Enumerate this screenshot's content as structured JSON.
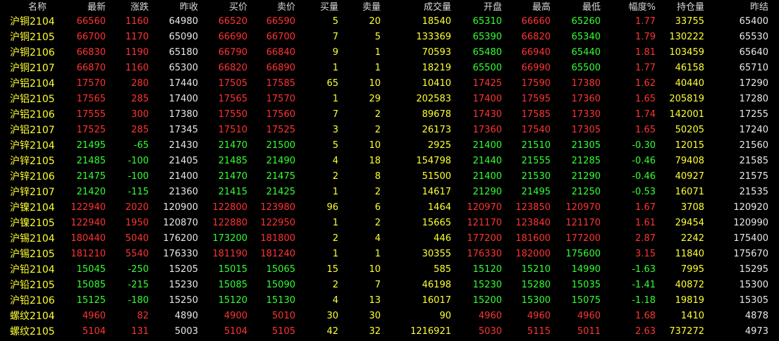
{
  "colors": {
    "background": "#000000",
    "header_text": "#d8d8d8",
    "name": "#ffff33",
    "up": "#ff3333",
    "down": "#33ff33",
    "neutral": "#e8e8e8",
    "volume": "#ffff33"
  },
  "columns": [
    {
      "key": "name",
      "label": "名称"
    },
    {
      "key": "last",
      "label": "最新"
    },
    {
      "key": "change",
      "label": "涨跌"
    },
    {
      "key": "prev_close",
      "label": "昨收"
    },
    {
      "key": "bid",
      "label": "买价"
    },
    {
      "key": "ask",
      "label": "卖价"
    },
    {
      "key": "bid_vol",
      "label": "买量"
    },
    {
      "key": "ask_vol",
      "label": "卖量"
    },
    {
      "key": "volume",
      "label": "成交量"
    },
    {
      "key": "open",
      "label": "开盘"
    },
    {
      "key": "high",
      "label": "最高"
    },
    {
      "key": "low",
      "label": "最低"
    },
    {
      "key": "pct",
      "label": "幅度%"
    },
    {
      "key": "oi",
      "label": "持仓量"
    },
    {
      "key": "prev_settle",
      "label": "昨结"
    }
  ],
  "rows": [
    {
      "name": "沪铜2104",
      "last": "66560",
      "change": "1160",
      "prev_close": "64980",
      "bid": "66520",
      "ask": "66590",
      "bid_vol": "5",
      "ask_vol": "20",
      "volume": "18540",
      "open": "65310",
      "high": "66660",
      "low": "65260",
      "pct": "1.77",
      "oi": "33755",
      "prev_settle": "65400"
    },
    {
      "name": "沪铜2105",
      "last": "66700",
      "change": "1170",
      "prev_close": "65090",
      "bid": "66690",
      "ask": "66700",
      "bid_vol": "7",
      "ask_vol": "5",
      "volume": "133369",
      "open": "65390",
      "high": "66820",
      "low": "65340",
      "pct": "1.79",
      "oi": "130222",
      "prev_settle": "65530"
    },
    {
      "name": "沪铜2106",
      "last": "66830",
      "change": "1190",
      "prev_close": "65180",
      "bid": "66790",
      "ask": "66840",
      "bid_vol": "9",
      "ask_vol": "1",
      "volume": "70593",
      "open": "65480",
      "high": "66940",
      "low": "65440",
      "pct": "1.81",
      "oi": "103459",
      "prev_settle": "65640"
    },
    {
      "name": "沪铜2107",
      "last": "66870",
      "change": "1160",
      "prev_close": "65300",
      "bid": "66820",
      "ask": "66890",
      "bid_vol": "1",
      "ask_vol": "1",
      "volume": "18219",
      "open": "65500",
      "high": "66990",
      "low": "65500",
      "pct": "1.77",
      "oi": "46158",
      "prev_settle": "65710"
    },
    {
      "name": "沪铝2104",
      "last": "17570",
      "change": "280",
      "prev_close": "17440",
      "bid": "17505",
      "ask": "17585",
      "bid_vol": "65",
      "ask_vol": "10",
      "volume": "10410",
      "open": "17425",
      "high": "17590",
      "low": "17380",
      "pct": "1.62",
      "oi": "40440",
      "prev_settle": "17290"
    },
    {
      "name": "沪铝2105",
      "last": "17565",
      "change": "285",
      "prev_close": "17400",
      "bid": "17565",
      "ask": "17570",
      "bid_vol": "1",
      "ask_vol": "29",
      "volume": "202583",
      "open": "17400",
      "high": "17595",
      "low": "17360",
      "pct": "1.65",
      "oi": "205819",
      "prev_settle": "17280"
    },
    {
      "name": "沪铝2106",
      "last": "17555",
      "change": "300",
      "prev_close": "17380",
      "bid": "17550",
      "ask": "17560",
      "bid_vol": "7",
      "ask_vol": "2",
      "volume": "89678",
      "open": "17430",
      "high": "17585",
      "low": "17330",
      "pct": "1.74",
      "oi": "142001",
      "prev_settle": "17255"
    },
    {
      "name": "沪铝2107",
      "last": "17525",
      "change": "285",
      "prev_close": "17345",
      "bid": "17510",
      "ask": "17525",
      "bid_vol": "3",
      "ask_vol": "2",
      "volume": "26173",
      "open": "17360",
      "high": "17540",
      "low": "17305",
      "pct": "1.65",
      "oi": "50205",
      "prev_settle": "17240"
    },
    {
      "name": "沪锌2104",
      "last": "21495",
      "change": "-65",
      "prev_close": "21430",
      "bid": "21470",
      "ask": "21500",
      "bid_vol": "5",
      "ask_vol": "10",
      "volume": "2925",
      "open": "21400",
      "high": "21510",
      "low": "21305",
      "pct": "-0.30",
      "oi": "12015",
      "prev_settle": "21560"
    },
    {
      "name": "沪锌2105",
      "last": "21485",
      "change": "-100",
      "prev_close": "21405",
      "bid": "21485",
      "ask": "21490",
      "bid_vol": "4",
      "ask_vol": "18",
      "volume": "154798",
      "open": "21440",
      "high": "21555",
      "low": "21285",
      "pct": "-0.46",
      "oi": "79408",
      "prev_settle": "21585"
    },
    {
      "name": "沪锌2106",
      "last": "21475",
      "change": "-100",
      "prev_close": "21400",
      "bid": "21470",
      "ask": "21475",
      "bid_vol": "2",
      "ask_vol": "8",
      "volume": "51500",
      "open": "21400",
      "high": "21530",
      "low": "21290",
      "pct": "-0.46",
      "oi": "40927",
      "prev_settle": "21575"
    },
    {
      "name": "沪锌2107",
      "last": "21420",
      "change": "-115",
      "prev_close": "21360",
      "bid": "21415",
      "ask": "21425",
      "bid_vol": "1",
      "ask_vol": "2",
      "volume": "14617",
      "open": "21290",
      "high": "21495",
      "low": "21250",
      "pct": "-0.53",
      "oi": "16071",
      "prev_settle": "21535"
    },
    {
      "name": "沪镍2104",
      "last": "122940",
      "change": "2020",
      "prev_close": "120900",
      "bid": "122800",
      "ask": "123980",
      "bid_vol": "96",
      "ask_vol": "6",
      "volume": "1464",
      "open": "120970",
      "high": "123850",
      "low": "120970",
      "pct": "1.67",
      "oi": "3708",
      "prev_settle": "120920"
    },
    {
      "name": "沪镍2105",
      "last": "122940",
      "change": "1950",
      "prev_close": "120870",
      "bid": "122880",
      "ask": "122950",
      "bid_vol": "1",
      "ask_vol": "2",
      "volume": "15665",
      "open": "121170",
      "high": "123840",
      "low": "121170",
      "pct": "1.61",
      "oi": "29454",
      "prev_settle": "120990"
    },
    {
      "name": "沪锡2104",
      "last": "180440",
      "change": "5040",
      "prev_close": "176200",
      "bid": "173200",
      "ask": "181800",
      "bid_vol": "2",
      "ask_vol": "4",
      "volume": "446",
      "open": "177200",
      "high": "181600",
      "low": "177200",
      "pct": "2.87",
      "oi": "2242",
      "prev_settle": "175400"
    },
    {
      "name": "沪锡2105",
      "last": "181210",
      "change": "5540",
      "prev_close": "176330",
      "bid": "181190",
      "ask": "181240",
      "bid_vol": "1",
      "ask_vol": "1",
      "volume": "30355",
      "open": "176330",
      "high": "182000",
      "low": "175600",
      "pct": "3.15",
      "oi": "11840",
      "prev_settle": "175670"
    },
    {
      "name": "沪铅2104",
      "last": "15045",
      "change": "-250",
      "prev_close": "15205",
      "bid": "15015",
      "ask": "15065",
      "bid_vol": "15",
      "ask_vol": "10",
      "volume": "585",
      "open": "15120",
      "high": "15210",
      "low": "14990",
      "pct": "-1.63",
      "oi": "7995",
      "prev_settle": "15295"
    },
    {
      "name": "沪铅2105",
      "last": "15085",
      "change": "-215",
      "prev_close": "15230",
      "bid": "15085",
      "ask": "15090",
      "bid_vol": "2",
      "ask_vol": "7",
      "volume": "46198",
      "open": "15230",
      "high": "15280",
      "low": "15035",
      "pct": "-1.41",
      "oi": "40872",
      "prev_settle": "15300"
    },
    {
      "name": "沪铅2106",
      "last": "15125",
      "change": "-180",
      "prev_close": "15250",
      "bid": "15120",
      "ask": "15130",
      "bid_vol": "4",
      "ask_vol": "13",
      "volume": "16017",
      "open": "15200",
      "high": "15300",
      "low": "15075",
      "pct": "-1.18",
      "oi": "19819",
      "prev_settle": "15305"
    },
    {
      "name": "螺纹2104",
      "last": "4960",
      "change": "82",
      "prev_close": "4890",
      "bid": "4900",
      "ask": "5010",
      "bid_vol": "30",
      "ask_vol": "30",
      "volume": "90",
      "open": "4960",
      "high": "4960",
      "low": "4960",
      "pct": "1.68",
      "oi": "1410",
      "prev_settle": "4878"
    },
    {
      "name": "螺纹2105",
      "last": "5104",
      "change": "131",
      "prev_close": "5003",
      "bid": "5104",
      "ask": "5105",
      "bid_vol": "42",
      "ask_vol": "32",
      "volume": "1216921",
      "open": "5030",
      "high": "5115",
      "low": "5011",
      "pct": "2.63",
      "oi": "737272",
      "prev_settle": "4973"
    }
  ]
}
